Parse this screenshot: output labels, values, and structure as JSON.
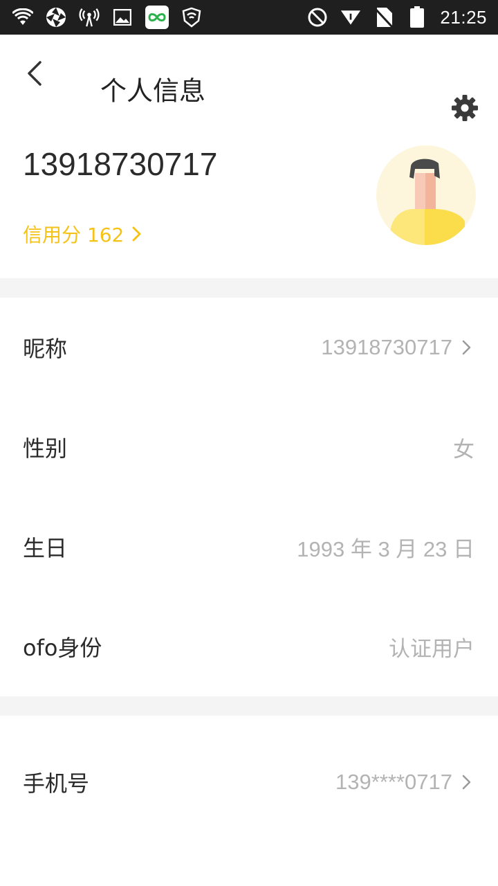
{
  "status_bar": {
    "time": "21:25",
    "battery": "89",
    "icons_left": [
      "wifi-icon",
      "aperture-icon",
      "hotspot-icon",
      "image-icon",
      "app-icon",
      "shield-icon"
    ],
    "icons_right": [
      "do-not-disturb-icon",
      "signal-icon",
      "no-sim-icon",
      "battery-icon"
    ]
  },
  "header": {
    "title": "个人信息"
  },
  "profile": {
    "phone": "13918730717",
    "credit_label": "信用分 162"
  },
  "rows_group1": [
    {
      "label": "昵称",
      "value": "13918730717",
      "chevron": true
    },
    {
      "label": "性别",
      "value": "女",
      "chevron": false
    },
    {
      "label": "生日",
      "value": "1993 年 3 月 23 日",
      "chevron": false
    },
    {
      "label": "ofo身份",
      "value": "认证用户",
      "chevron": false
    }
  ],
  "rows_group2": [
    {
      "label": "手机号",
      "value": "139****0717",
      "chevron": true
    }
  ],
  "colors": {
    "accent": "#f5c218",
    "status_bar": "#1f1f1f",
    "divider": "#f4f4f4",
    "muted_text": "#b3b3b3"
  }
}
